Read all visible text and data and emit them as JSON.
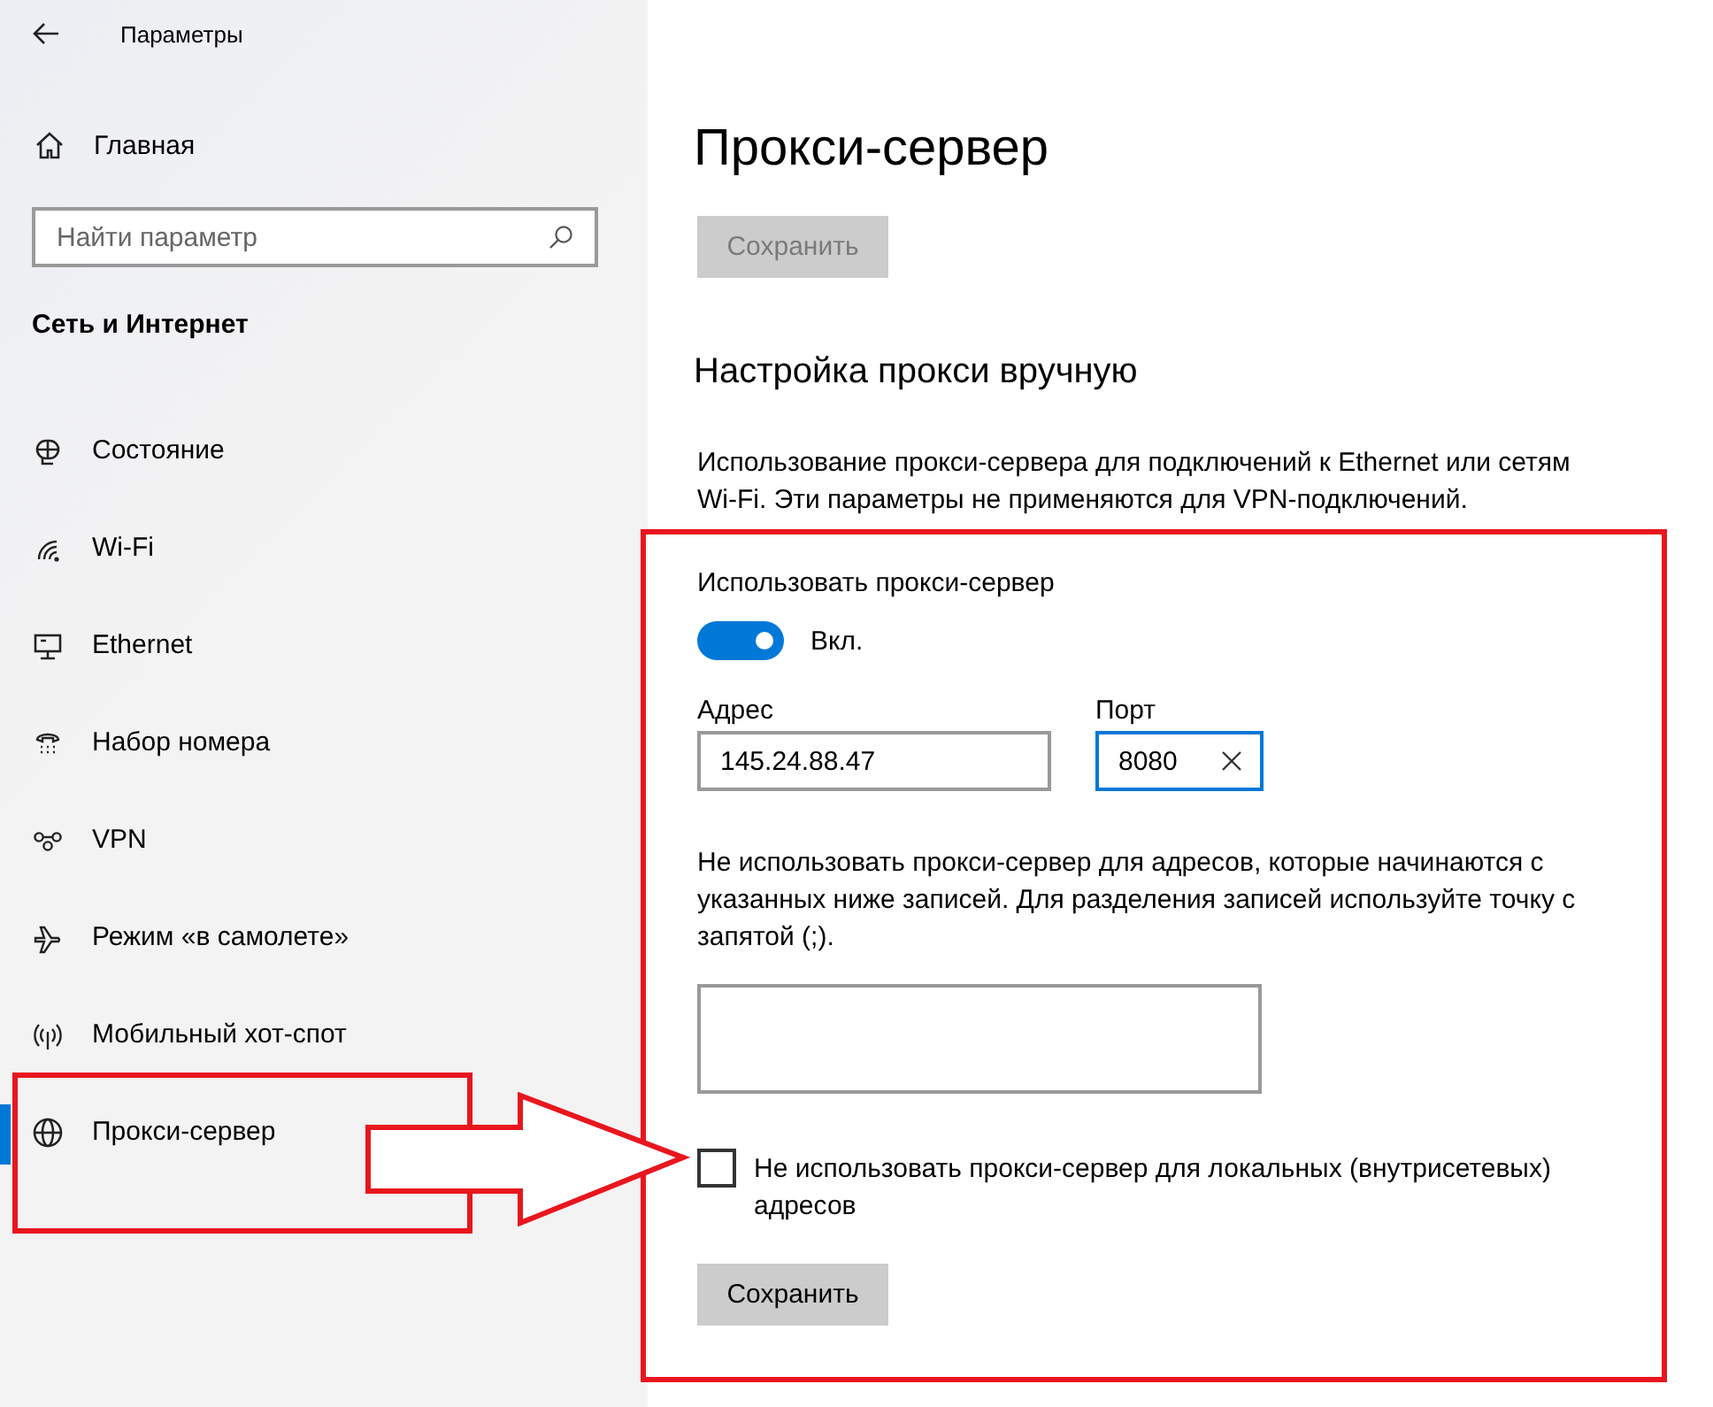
{
  "window": {
    "title": "Параметры"
  },
  "sidebar": {
    "home": "Главная",
    "search": {
      "placeholder": "Найти параметр"
    },
    "section": "Сеть и Интернет",
    "items": [
      {
        "label": "Состояние",
        "selected": false
      },
      {
        "label": "Wi-Fi",
        "selected": false
      },
      {
        "label": "Ethernet",
        "selected": false
      },
      {
        "label": "Набор номера",
        "selected": false
      },
      {
        "label": "VPN",
        "selected": false
      },
      {
        "label": "Режим «в самолете»",
        "selected": false
      },
      {
        "label": "Мобильный хот-спот",
        "selected": false
      },
      {
        "label": "Прокси-сервер",
        "selected": true
      }
    ]
  },
  "main": {
    "title": "Прокси-сервер",
    "save_top": {
      "label": "Сохранить",
      "disabled": true
    },
    "section_title": "Настройка прокси вручную",
    "description": "Использование прокси-сервера для подключений к Ethernet или сетям Wi-Fi. Эти параметры не применяются для VPN-подключений.",
    "use_proxy": {
      "label": "Использовать прокси-сервер",
      "on": true,
      "state_text": "Вкл."
    },
    "address": {
      "label": "Адрес",
      "value": "145.24.88.47",
      "focused": false
    },
    "port": {
      "label": "Порт",
      "value": "8080",
      "focused": true
    },
    "exclusions": {
      "label": "Не использовать прокси-сервер для адресов, которые начинаются с указанных ниже записей. Для разделения записей используйте точку с запятой (;)."
    },
    "local": {
      "label": "Не использовать прокси-сервер для локальных (внутрисетевых) адресов",
      "checked": false
    },
    "save": {
      "label": "Сохранить",
      "disabled": false
    }
  }
}
